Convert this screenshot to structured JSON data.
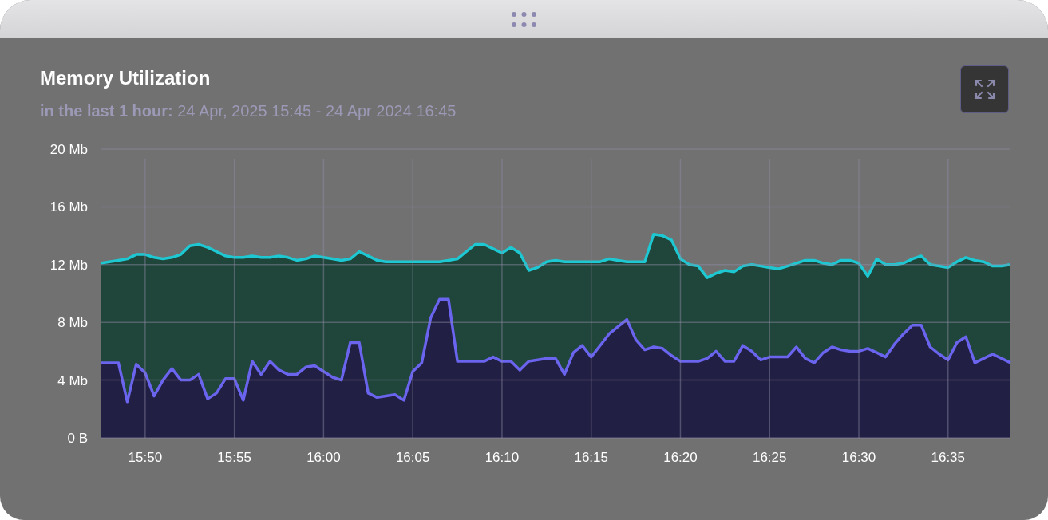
{
  "card": {
    "title": "Memory Utilization",
    "subtitle": "**in the last 1 hour:** 24 Apr, 2025 15:45 - 24 Apr 2024 16:45",
    "chart_data": {
      "type": "area",
      "stacked": false,
      "grid": true,
      "ylim": [
        0,
        20
      ],
      "categories": [
        null,
        null,
        null,
        null,
        null,
        "15:50",
        null,
        null,
        null,
        null,
        null,
        null,
        null,
        null,
        null,
        "15:55",
        null,
        null,
        null,
        null,
        null,
        null,
        null,
        null,
        null,
        "16:00",
        null,
        null,
        null,
        null,
        null,
        null,
        null,
        null,
        null,
        "16:05",
        null,
        null,
        null,
        null,
        null,
        null,
        null,
        null,
        null,
        "16:10",
        null,
        null,
        null,
        null,
        null,
        null,
        null,
        null,
        null,
        "16:15",
        null,
        null,
        null,
        null,
        null,
        null,
        null,
        null,
        null,
        "16:20",
        null,
        null,
        null,
        null,
        null,
        null,
        null,
        null,
        null,
        "16:25",
        null,
        null,
        null,
        null,
        null,
        null,
        null,
        null,
        null,
        "16:30",
        null,
        null,
        null,
        null,
        null,
        null,
        null,
        null,
        null,
        "16:35",
        null,
        null,
        null,
        null,
        null,
        null,
        null
      ],
      "series": [
        {
          "color": "#1ec8d2",
          "values": [
            12.1,
            12.2,
            12.3,
            12.4,
            12.7,
            12.7,
            12.5,
            12.4,
            12.5,
            12.7,
            13.3,
            13.4,
            13.2,
            12.9,
            12.6,
            12.5,
            12.5,
            12.6,
            12.5,
            12.5,
            12.6,
            12.5,
            12.3,
            12.4,
            12.6,
            12.5,
            12.4,
            12.3,
            12.4,
            12.9,
            12.6,
            12.3,
            12.2,
            12.2,
            12.2,
            12.2,
            12.2,
            12.2,
            12.2,
            12.3,
            12.4,
            12.9,
            13.4,
            13.4,
            13.1,
            12.8,
            13.2,
            12.8,
            11.6,
            11.8,
            12.2,
            12.3,
            12.2,
            12.2,
            12.2,
            12.2,
            12.2,
            12.4,
            12.3,
            12.2,
            12.2,
            12.2,
            14.1,
            14.0,
            13.7,
            12.4,
            12.0,
            11.9,
            11.1,
            11.4,
            11.6,
            11.5,
            11.9,
            12.0,
            11.9,
            11.8,
            11.7,
            11.9,
            12.1,
            12.3,
            12.3,
            12.1,
            12.0,
            12.3,
            12.3,
            12.1,
            11.2,
            12.4,
            12.0,
            12.0,
            12.1,
            12.4,
            12.6,
            12.0,
            11.9,
            11.8,
            12.2,
            12.5,
            12.3,
            12.2,
            11.9,
            11.9,
            12.0
          ]
        },
        {
          "color": "#6a64ee",
          "values": [
            5.2,
            5.2,
            5.2,
            2.5,
            5.1,
            4.5,
            2.9,
            4.0,
            4.8,
            4.0,
            4.0,
            4.4,
            2.7,
            3.1,
            4.1,
            4.1,
            2.6,
            5.3,
            4.4,
            5.3,
            4.7,
            4.4,
            4.4,
            4.9,
            5.0,
            4.6,
            4.2,
            4.0,
            6.6,
            6.6,
            3.1,
            2.8,
            2.9,
            3.0,
            2.6,
            4.6,
            5.2,
            8.3,
            9.6,
            9.6,
            5.3,
            5.3,
            5.3,
            5.3,
            5.6,
            5.3,
            5.3,
            4.7,
            5.3,
            5.4,
            5.5,
            5.5,
            4.4,
            5.9,
            6.4,
            5.6,
            6.4,
            7.2,
            7.7,
            8.2,
            6.8,
            6.1,
            6.3,
            6.2,
            5.7,
            5.3,
            5.3,
            5.3,
            5.5,
            6.0,
            5.3,
            5.3,
            6.4,
            6.0,
            5.4,
            5.6,
            5.6,
            5.6,
            6.3,
            5.5,
            5.2,
            5.9,
            6.3,
            6.1,
            6.0,
            6.0,
            6.2,
            5.9,
            5.6,
            6.5,
            7.2,
            7.8,
            7.8,
            6.3,
            5.8,
            5.4,
            6.6,
            7.0,
            5.2,
            5.5,
            5.8,
            5.5,
            5.2
          ]
        }
      ],
      "yticks": [
        {
          "value": 0,
          "label": "0 B"
        },
        {
          "value": 4,
          "label": "4 Mb"
        },
        {
          "value": 8,
          "label": "8 Mb"
        },
        {
          "value": 12,
          "label": "12 Mb"
        },
        {
          "value": 16,
          "label": "16 Mb"
        },
        {
          "value": 20,
          "label": "20 Mb"
        }
      ]
    }
  }
}
